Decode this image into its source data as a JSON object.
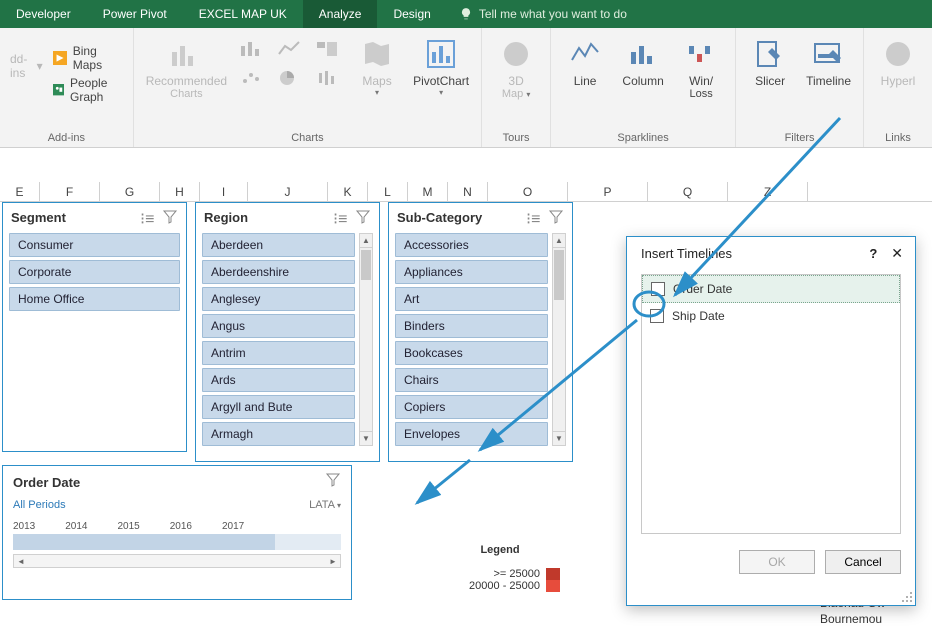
{
  "ribbon": {
    "tabs": [
      "Developer",
      "Power Pivot",
      "EXCEL MAP UK",
      "Analyze",
      "Design"
    ],
    "active_tab_index": 3,
    "tellme": "Tell me what you want to do",
    "groups": {
      "addins": {
        "label": "Add-ins",
        "bing": "Bing Maps",
        "people": "People Graph"
      },
      "charts": {
        "label": "Charts",
        "rec1": "Recommended",
        "rec2": "Charts",
        "maps": "Maps",
        "pivot1": "PivotChart"
      },
      "tours": {
        "label": "Tours",
        "m1": "3D",
        "m2": "Map"
      },
      "spark": {
        "label": "Sparklines",
        "line": "Line",
        "col": "Column",
        "wl1": "Win/",
        "wl2": "Loss"
      },
      "filters": {
        "label": "Filters",
        "slicer": "Slicer",
        "timeline": "Timeline"
      },
      "links": {
        "label": "Links",
        "hyper": "Hyperl"
      }
    }
  },
  "columns": [
    "E",
    "F",
    "G",
    "H",
    "I",
    "J",
    "K",
    "L",
    "M",
    "N",
    "O",
    "P",
    "Q",
    "Z"
  ],
  "slicers": {
    "segment": {
      "title": "Segment",
      "items": [
        "Consumer",
        "Corporate",
        "Home Office"
      ]
    },
    "region": {
      "title": "Region",
      "items": [
        "Aberdeen",
        "Aberdeenshire",
        "Anglesey",
        "Angus",
        "Antrim",
        "Ards",
        "Argyll and Bute",
        "Armagh"
      ]
    },
    "subcat": {
      "title": "Sub-Category",
      "items": [
        "Accessories",
        "Appliances",
        "Art",
        "Binders",
        "Bookcases",
        "Chairs",
        "Copiers",
        "Envelopes"
      ]
    }
  },
  "timeline": {
    "title": "Order Date",
    "period": "All Periods",
    "granularity": "LATA",
    "years": [
      "2013",
      "2014",
      "2015",
      "2016",
      "2017"
    ]
  },
  "dialog": {
    "title": "Insert Timelines",
    "opt1": "Order Date",
    "opt2": "Ship Date",
    "ok": "OK",
    "cancel": "Cancel",
    "help": "?",
    "close": "✕"
  },
  "legend": {
    "title": "Legend",
    "r1": ">=    25000",
    "r2": "20000 - 25000"
  },
  "right_text": [
    "Blaenau Gw",
    "Bournemou"
  ]
}
